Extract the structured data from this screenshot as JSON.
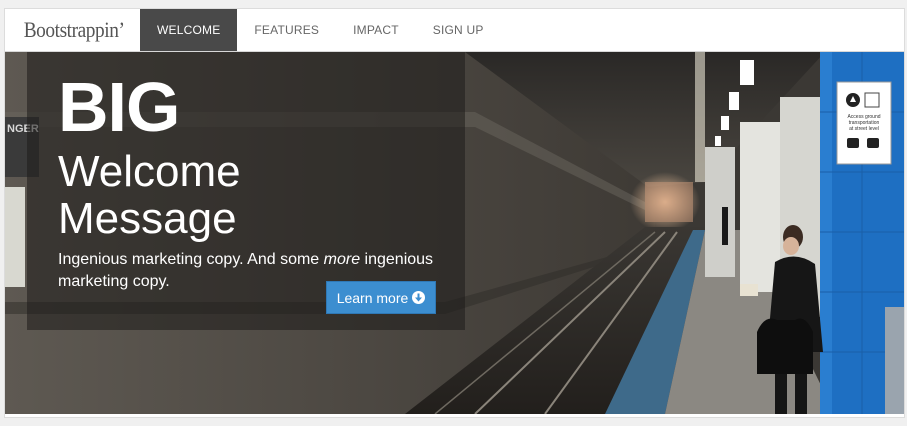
{
  "brand": {
    "name": "Bootstrappin’"
  },
  "nav": {
    "items": [
      {
        "label": "WELCOME",
        "active": true
      },
      {
        "label": "FEATURES",
        "active": false
      },
      {
        "label": "IMPACT",
        "active": false
      },
      {
        "label": "SIGN UP",
        "active": false
      }
    ]
  },
  "hero": {
    "headline_big": "BIG",
    "headline_sub": "Welcome Message",
    "copy_before": "Ingenious marketing copy. And some ",
    "copy_em": "more",
    "copy_after": " ingenious marketing copy.",
    "button_label": "Learn more",
    "button_icon": "arrow-circle-down-icon",
    "sign_text_1": "Access ground",
    "sign_text_2": "transportation",
    "sign_text_3": "at street level",
    "wall_sign": "NGER"
  },
  "colors": {
    "nav_active_bg": "#494949",
    "button_bg": "#3c8ed0",
    "pillar_blue": "#1e6fc2"
  }
}
